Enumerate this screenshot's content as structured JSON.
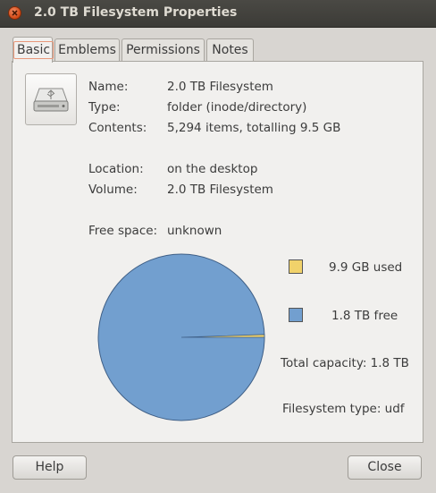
{
  "window": {
    "title": "2.0 TB Filesystem Properties"
  },
  "tabs": [
    {
      "label": "Basic"
    },
    {
      "label": "Emblems"
    },
    {
      "label": "Permissions"
    },
    {
      "label": "Notes"
    }
  ],
  "icon": {
    "name": "drive-harddisk-usb-icon"
  },
  "info": {
    "name_label": "Name:",
    "name_value": "2.0 TB Filesystem",
    "type_label": "Type:",
    "type_value": "folder (inode/directory)",
    "contents_label": "Contents:",
    "contents_value": "5,294 items, totalling 9.5 GB",
    "location_label": "Location:",
    "location_value": "on the desktop",
    "volume_label": "Volume:",
    "volume_value": "2.0 TB Filesystem",
    "free_label": "Free space:",
    "free_value": "unknown"
  },
  "usage": {
    "used_label": "9.9 GB used",
    "free_label": "1.8 TB free",
    "total_capacity": "Total capacity: 1.8 TB",
    "fs_type": "Filesystem type: udf",
    "used_fraction": 0.0054,
    "used_color": "#f1d26a",
    "free_color": "#729fcf"
  },
  "buttons": {
    "help": "Help",
    "close": "Close"
  }
}
